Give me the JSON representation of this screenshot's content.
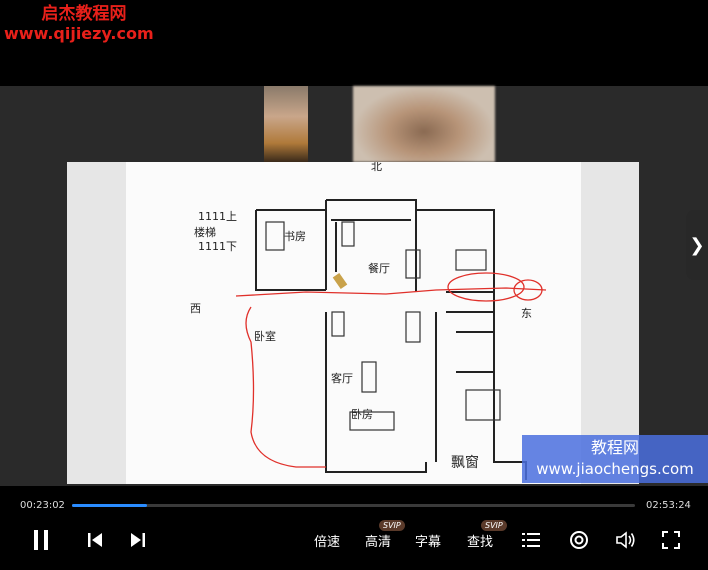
{
  "watermark_top": {
    "line1": "启杰教程网",
    "line2": "www.qijiezy.com"
  },
  "watermark_bottom": {
    "line1": "教程网",
    "line2": "www.jiaochengs.com"
  },
  "floorplan": {
    "north": "北",
    "west": "西",
    "east": "东",
    "note_line1": "1111上",
    "note_line2": "楼梯",
    "note_line3": "1111下",
    "rooms": {
      "bedroom": "卧房",
      "living": "客厅",
      "dining": "餐厅",
      "study": "书房",
      "bay_window": "飘窗",
      "other": "卧室"
    }
  },
  "player": {
    "current_time": "00:23:02",
    "total_time": "02:53:24",
    "progress": 0.133,
    "speed_label": "倍速",
    "quality_label": "高清",
    "quality_badge": "SVIP",
    "subtitle_label": "字幕",
    "find_label": "查找",
    "find_badge": "SVIP",
    "accent_color": "#2a8cff"
  }
}
